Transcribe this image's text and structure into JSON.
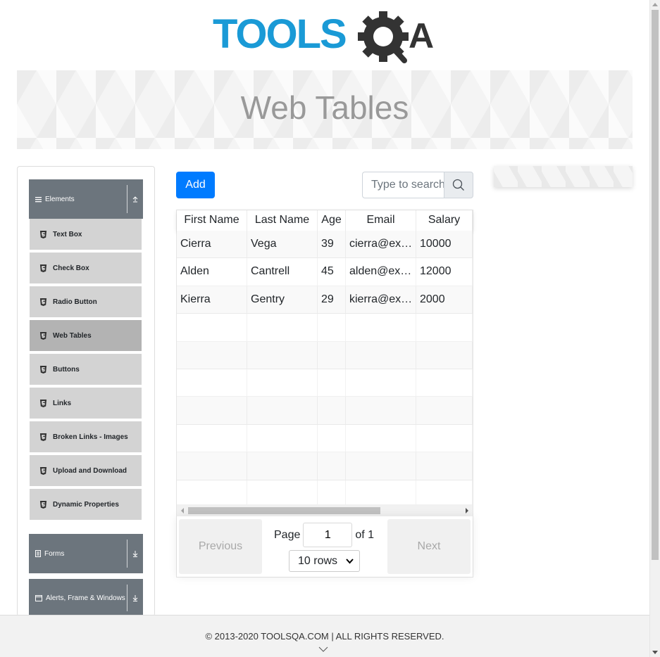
{
  "logo": {
    "part1": "TOOLS",
    "part2": "A"
  },
  "banner": {
    "title": "Web Tables"
  },
  "sidebar": {
    "groups": [
      {
        "label": "Elements",
        "icon": "menu-icon",
        "arrow": "chevron-up-icon"
      },
      {
        "label": "Forms",
        "icon": "document-icon",
        "arrow": "chevron-down-icon"
      },
      {
        "label": "Alerts, Frame & Windows",
        "icon": "window-icon",
        "arrow": "chevron-down-icon"
      }
    ],
    "items": [
      {
        "label": "Text Box"
      },
      {
        "label": "Check Box"
      },
      {
        "label": "Radio Button"
      },
      {
        "label": "Web Tables"
      },
      {
        "label": "Buttons"
      },
      {
        "label": "Links"
      },
      {
        "label": "Broken Links - Images"
      },
      {
        "label": "Upload and Download"
      },
      {
        "label": "Dynamic Properties"
      }
    ],
    "active_item": "Web Tables"
  },
  "toolbar": {
    "add_label": "Add",
    "search_placeholder": "Type to search"
  },
  "table": {
    "headers": [
      "First Name",
      "Last Name",
      "Age",
      "Email",
      "Salary"
    ],
    "rows": [
      [
        "Cierra",
        "Vega",
        "39",
        "cierra@example.com",
        "10000"
      ],
      [
        "Alden",
        "Cantrell",
        "45",
        "alden@example.com",
        "12000"
      ],
      [
        "Kierra",
        "Gentry",
        "29",
        "kierra@example.com",
        "2000"
      ]
    ]
  },
  "pager": {
    "previous_label": "Previous",
    "next_label": "Next",
    "page_label": "Page",
    "page_value": "1",
    "of_label": "of 1",
    "rows_selected": "10 rows"
  },
  "footer": {
    "copyright": "© 2013-2020 TOOLSQA.COM | ALL RIGHTS RESERVED."
  },
  "colors": {
    "brand_blue": "#1a9ad6",
    "brand_dark": "#333333",
    "primary": "#007bff",
    "sidebar_header": "#6c757d",
    "sidebar_item": "#d3d3d3"
  }
}
